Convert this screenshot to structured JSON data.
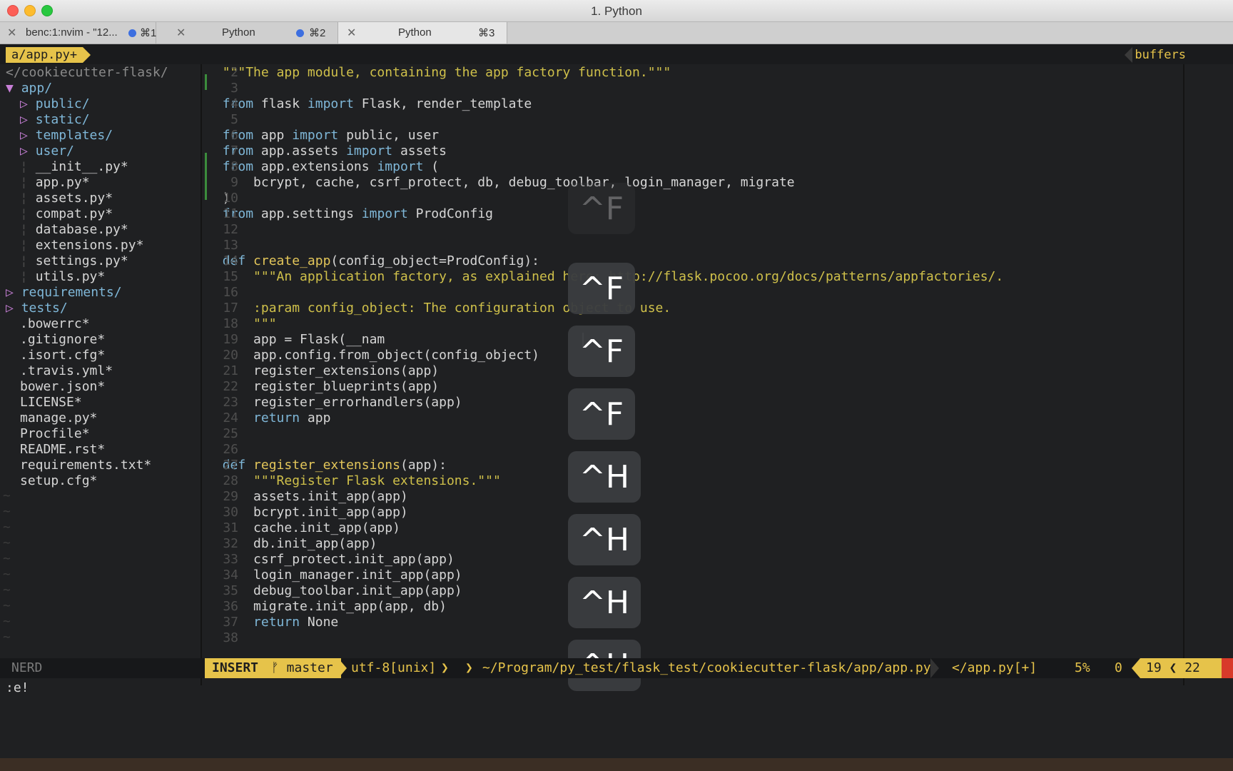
{
  "window": {
    "title": "1. Python"
  },
  "tabs": [
    {
      "label": "benc:1:nvim - \"12...",
      "shortcut": "⌘1"
    },
    {
      "label": "Python",
      "shortcut": "⌘2"
    },
    {
      "label": "Python",
      "shortcut": "⌘3"
    }
  ],
  "topbar": {
    "file": "a/app.py+",
    "buffers": "buffers"
  },
  "tree": {
    "root": "</cookiecutter-flask/",
    "items": [
      "app/",
      "public/",
      "static/",
      "templates/",
      "user/",
      "__init__.py*",
      "app.py*",
      "assets.py*",
      "compat.py*",
      "database.py*",
      "extensions.py*",
      "settings.py*",
      "utils.py*",
      "requirements/",
      "tests/",
      ".bowerrc*",
      ".gitignore*",
      ".isort.cfg*",
      ".travis.yml*",
      "bower.json*",
      "LICENSE*",
      "manage.py*",
      "Procfile*",
      "README.rst*",
      "requirements.txt*",
      "setup.cfg*"
    ]
  },
  "code": {
    "line_numbers": [
      "2",
      "3",
      "4",
      "5",
      "6",
      "7",
      "8",
      "9",
      "10",
      "11",
      "12",
      "13",
      "14",
      "15",
      "16",
      "17",
      "18",
      "19",
      "20",
      "21",
      "22",
      "23",
      "24",
      "25",
      "26",
      "27",
      "28",
      "29",
      "30",
      "31",
      "32",
      "33",
      "34",
      "35",
      "36",
      "37",
      "38"
    ],
    "l2": "\"\"\"The app module, containing the app factory function.\"\"\"",
    "from": "from",
    "import": "import",
    "def": "def",
    "return": "return",
    "l4a": " flask ",
    "l4b": " Flask, render_template",
    "l6a": " app ",
    "l6b": " public, user",
    "l7a": " app.assets ",
    "l7b": " assets",
    "l8a": " app.extensions ",
    "l8b": " (",
    "l9": "    bcrypt, cache, csrf_protect, db, debug_toolbar, login_manager, migrate",
    "l10": ")",
    "l11a": " app.settings ",
    "l11b": " ProdConfig",
    "l14fn": "create_app",
    "l14b": "(config_object=ProdConfig):",
    "l15": "    \"\"\"An application factory, as explained here: http://flask.pocoo.org/docs/patterns/appfactories/.",
    "l17": "    :param config_object: The configuration object to use.",
    "l18": "    \"\"\"",
    "l19": "    app = Flask(__nam",
    "l20": "    app.config.from_object(config_object)",
    "l21": "    register_extensions(app)",
    "l22": "    register_blueprints(app)",
    "l23": "    register_errorhandlers(app)",
    "l24b": " app",
    "l27fn": "register_extensions",
    "l27b": "(app):",
    "l28": "    \"\"\"Register Flask extensions.\"\"\"",
    "l29": "    assets.init_app(app)",
    "l30": "    bcrypt.init_app(app)",
    "l31": "    cache.init_app(app)",
    "l32": "    db.init_app(app)",
    "l33": "    csrf_protect.init_app(app)",
    "l34": "    login_manager.init_app(app)",
    "l35": "    debug_toolbar.init_app(app)",
    "l36": "    migrate.init_app(app, db)",
    "l37b": " None"
  },
  "keys": [
    "^F",
    "^F",
    "^F",
    "^F",
    "^H",
    "^H",
    "^H",
    "^H"
  ],
  "status": {
    "nerd": "NERD",
    "mode": "INSERT",
    "branch_icon": "ᚠ",
    "branch": "master",
    "encoding": "utf-8[unix]",
    "path": "~/Program/py_test/flask_test/cookiecutter-flask/app/app.py",
    "file": "</app.py[+]",
    "percent": "5%",
    "zero": "0",
    "line": "19",
    "col": "22"
  },
  "cmdline": ":e!",
  "colors": {
    "accent": "#e6c34a",
    "keyword": "#7fb7d8",
    "string": "#cfc04a",
    "tree_arrow": "#c77fd7"
  }
}
